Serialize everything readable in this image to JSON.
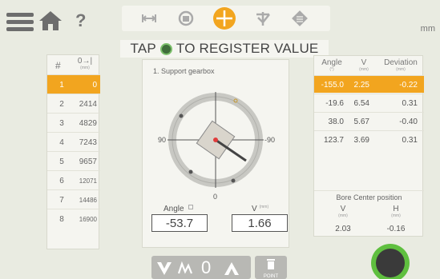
{
  "header": {
    "help_glyph": "?",
    "unit": "mm",
    "tabs": [
      {
        "icon": "distance-icon",
        "active": false
      },
      {
        "icon": "rotate-icon",
        "active": false
      },
      {
        "icon": "crosshair-icon",
        "active": true
      },
      {
        "icon": "check-angle-icon",
        "active": false
      },
      {
        "icon": "save-icon",
        "active": false
      }
    ]
  },
  "instruction": {
    "before": "TAP",
    "after": "TO REGISTER VALUE"
  },
  "positions": {
    "head_hash": "#",
    "head_distance": "0→|",
    "head_unit": "(mm)",
    "rows": [
      {
        "n": "1",
        "v": "0"
      },
      {
        "n": "2",
        "v": "2414"
      },
      {
        "n": "3",
        "v": "4829"
      },
      {
        "n": "4",
        "v": "7243"
      },
      {
        "n": "5",
        "v": "9657"
      },
      {
        "n": "6",
        "v": "12071"
      },
      {
        "n": "7",
        "v": "14486"
      },
      {
        "n": "8",
        "v": "16900"
      }
    ]
  },
  "measurement": {
    "caption": "1. Support gearbox",
    "left_tick": "90",
    "right_tick": "-90",
    "bottom_tick": "0",
    "angle_label": "Angle",
    "angle_value": "-53.7",
    "v_label": "V",
    "v_unit": "(mm)",
    "v_value": "1.66"
  },
  "results": {
    "head_angle": "Angle",
    "head_angle_unit": "(°)",
    "head_v": "V",
    "head_v_unit": "(mm)",
    "head_dev": "Deviation",
    "head_dev_unit": "(mm)",
    "rows": [
      {
        "angle": "-155.0",
        "v": "2.25",
        "dev": "-0.22"
      },
      {
        "angle": "-19.6",
        "v": "6.54",
        "dev": "0.31"
      },
      {
        "angle": "38.0",
        "v": "5.67",
        "dev": "-0.40"
      },
      {
        "angle": "123.7",
        "v": "3.69",
        "dev": "0.31"
      }
    ],
    "bore_title": "Bore Center position",
    "bore_v_label": "V",
    "bore_v_unit": "(mm)",
    "bore_v": "2.03",
    "bore_h_label": "H",
    "bore_h_unit": "(mm)",
    "bore_h": "-0.16"
  },
  "footer": {
    "filter_label": "0",
    "point_label": "POINT"
  },
  "colors": {
    "accent": "#f2a51f",
    "record_green": "#5fbf3f",
    "background": "#e9ebe1"
  }
}
